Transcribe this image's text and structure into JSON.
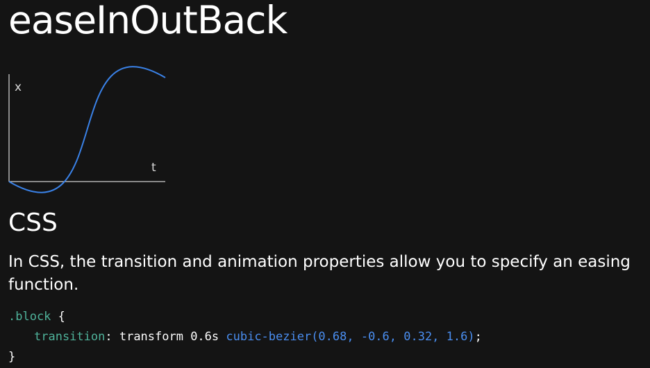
{
  "title": "easeInOutBack",
  "graph": {
    "y_axis_label": "x",
    "x_axis_label": "t",
    "curve_color": "#3a82e8",
    "axis_color": "#ffffff",
    "bezier": [
      0.68,
      -0.6,
      0.32,
      1.6
    ]
  },
  "section": {
    "heading": "CSS",
    "description": "In CSS, the transition and animation properties allow you to specify an easing function."
  },
  "code": {
    "selector": ".block",
    "open_brace": " {",
    "property": "transition",
    "colon": ": ",
    "value_plain": "transform 0.6s ",
    "value_function": "cubic-bezier(0.68, -0.6, 0.32, 1.6)",
    "semicolon": ";",
    "close_brace": "}"
  }
}
